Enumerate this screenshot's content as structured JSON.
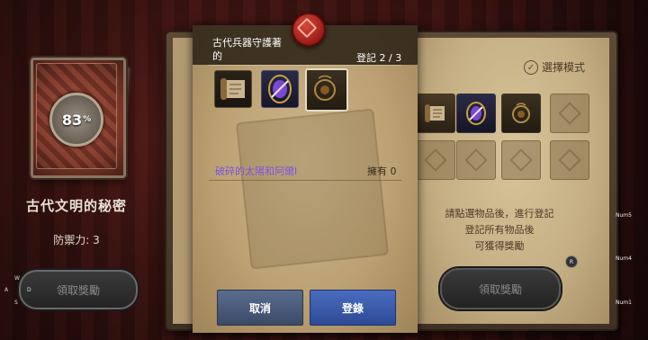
{
  "left_panel": {
    "progress_percent": "83",
    "progress_unit": "%",
    "title": "古代文明的秘密",
    "defense": "防禦力: 3",
    "claim_button": "領取獎勵",
    "keys": [
      "W",
      "A",
      "D",
      "S"
    ]
  },
  "book": {
    "mode_label": "選擇模式",
    "hint_lines": [
      "請點選物品後，進行登記",
      "登記所有物品後",
      "可獲得獎勵"
    ],
    "claim_button": "領取獎勵",
    "key_badge": "R",
    "num_keys": [
      "Num5",
      "Num4",
      "Num1"
    ]
  },
  "popup": {
    "title_line1": "古代兵器守護著",
    "title_line2": "的",
    "registered_count": "登記 2 / 3",
    "item_name": "破碎的太陽和阿爾I",
    "owned": "擁有 0",
    "cancel_button": "取消",
    "register_button": "登錄",
    "slots": [
      "scroll-icon",
      "gem-icon",
      "amulet-icon"
    ]
  },
  "colors": {
    "item_name": "#7a4ad0",
    "register_button": "#2d4a94",
    "cancel_button": "#3b4a66"
  }
}
